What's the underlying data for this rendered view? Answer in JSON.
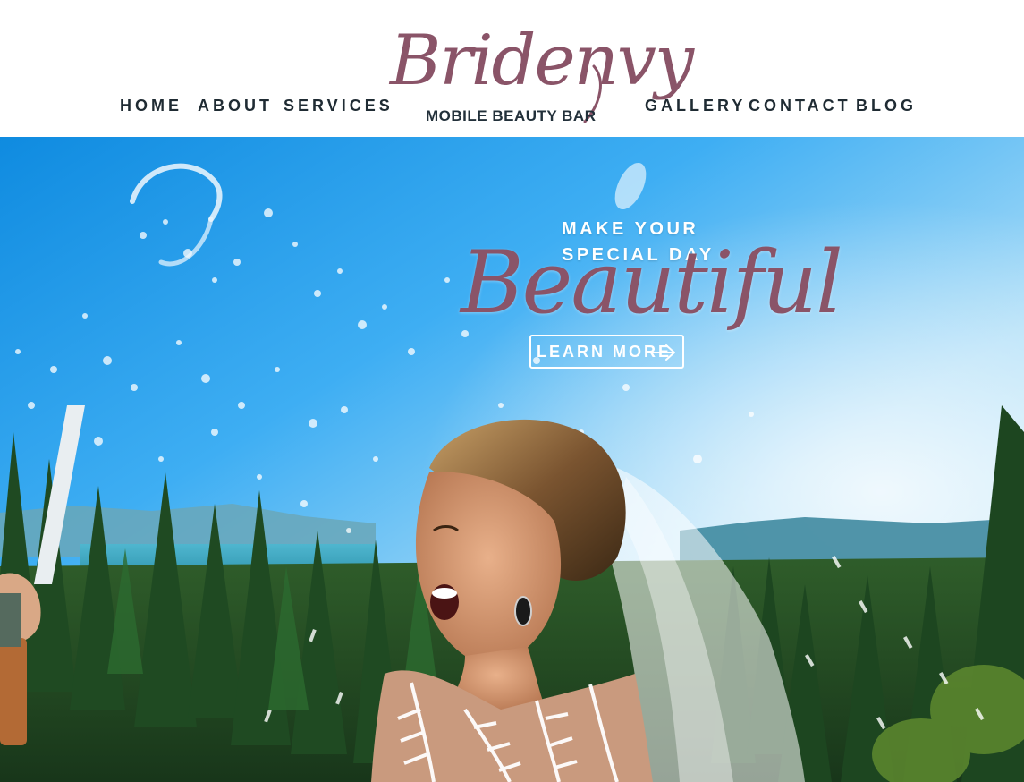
{
  "brand": {
    "script_name": "Bridenvy",
    "tagline": "MOBILE BEAUTY BAR",
    "accent_color": "#8a5468",
    "text_color": "#1f2b33"
  },
  "nav": {
    "left": [
      {
        "label": "HOME"
      },
      {
        "label": "ABOUT"
      },
      {
        "label": "SERVICES"
      }
    ],
    "right": [
      {
        "label": "GALLERY"
      },
      {
        "label": "CONTACT"
      },
      {
        "label": "BLOG"
      }
    ]
  },
  "hero": {
    "line1": "MAKE YOUR",
    "line2": "SPECIAL DAY",
    "script_word": "Beautiful",
    "cta_label": "LEARN MORE",
    "cta_icon": "arrow-right-icon",
    "image_description_icon": "hero-photo"
  }
}
